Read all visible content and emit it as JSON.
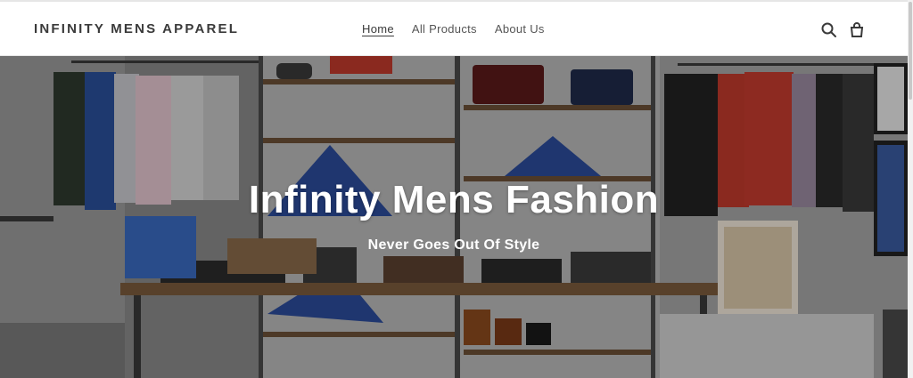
{
  "header": {
    "logo": "INFINITY MENS APPAREL",
    "nav": [
      {
        "label": "Home",
        "active": true
      },
      {
        "label": "All Products",
        "active": false
      },
      {
        "label": "About Us",
        "active": false
      }
    ],
    "icons": [
      "search-icon",
      "cart-icon"
    ]
  },
  "hero": {
    "title": "Infinity Mens Fashion",
    "subtitle": "Never Goes Out Of Style"
  },
  "colors": {
    "text": "#3a3a3a",
    "hero_text": "#ffffff",
    "accent_blue": "#2b4b9a",
    "accent_red": "#c0392b"
  }
}
